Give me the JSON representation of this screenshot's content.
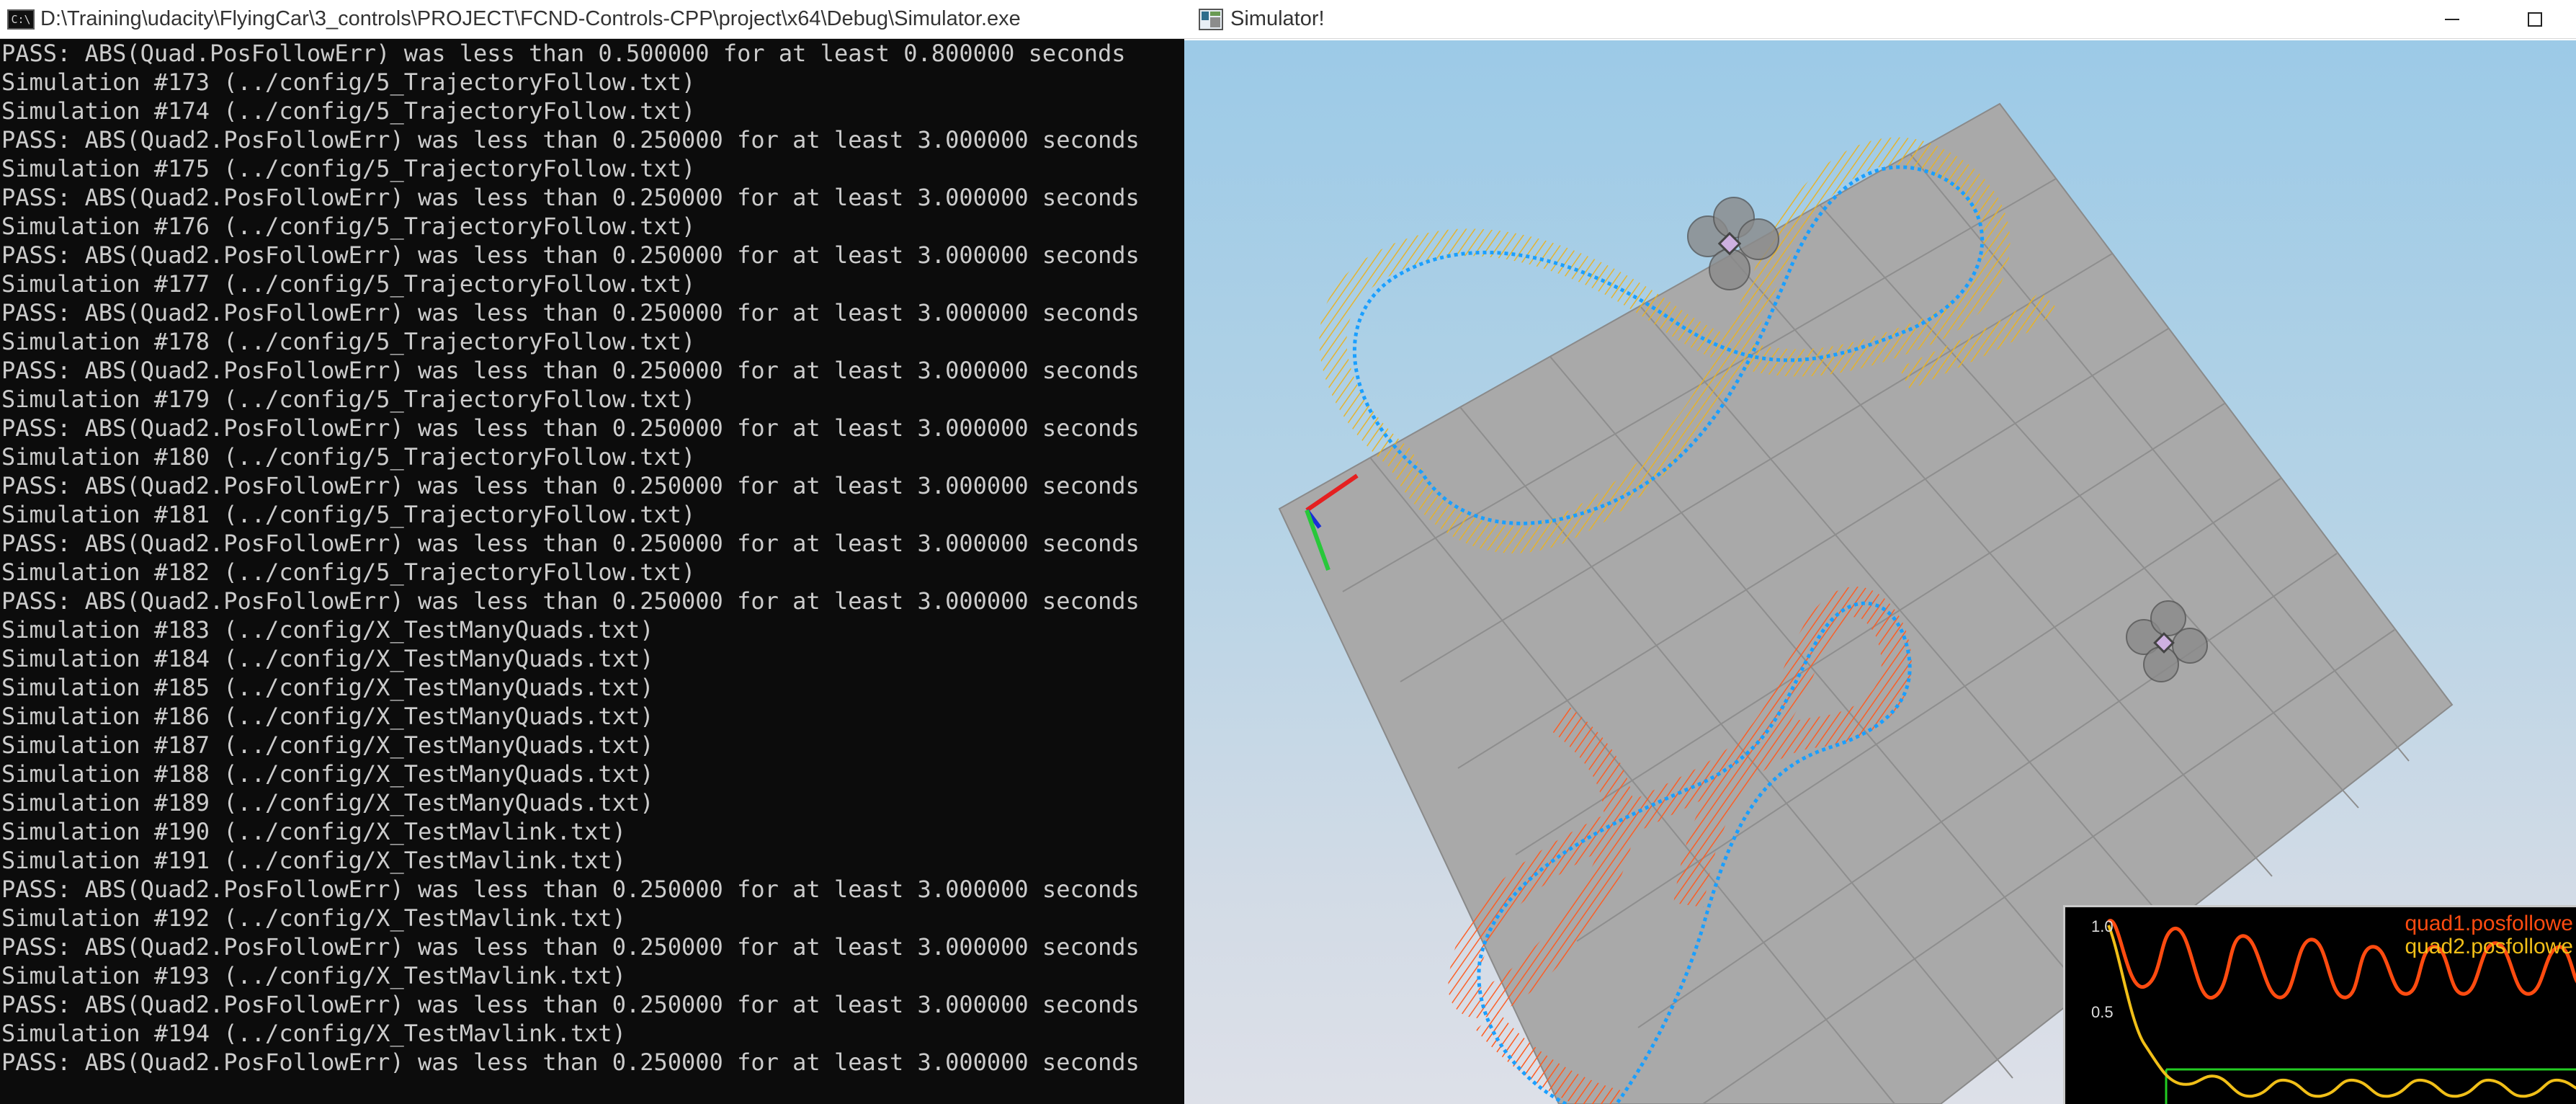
{
  "console": {
    "title": "D:\\Training\\udacity\\FlyingCar\\3_controls\\PROJECT\\FCND-Controls-CPP\\project\\x64\\Debug\\Simulator.exe",
    "icon": "cmd-icon",
    "lines": [
      "PASS: ABS(Quad.PosFollowErr) was less than 0.500000 for at least 0.800000 seconds",
      "Simulation #173 (../config/5_TrajectoryFollow.txt)",
      "Simulation #174 (../config/5_TrajectoryFollow.txt)",
      "PASS: ABS(Quad2.PosFollowErr) was less than 0.250000 for at least 3.000000 seconds",
      "Simulation #175 (../config/5_TrajectoryFollow.txt)",
      "PASS: ABS(Quad2.PosFollowErr) was less than 0.250000 for at least 3.000000 seconds",
      "Simulation #176 (../config/5_TrajectoryFollow.txt)",
      "PASS: ABS(Quad2.PosFollowErr) was less than 0.250000 for at least 3.000000 seconds",
      "Simulation #177 (../config/5_TrajectoryFollow.txt)",
      "PASS: ABS(Quad2.PosFollowErr) was less than 0.250000 for at least 3.000000 seconds",
      "Simulation #178 (../config/5_TrajectoryFollow.txt)",
      "PASS: ABS(Quad2.PosFollowErr) was less than 0.250000 for at least 3.000000 seconds",
      "Simulation #179 (../config/5_TrajectoryFollow.txt)",
      "PASS: ABS(Quad2.PosFollowErr) was less than 0.250000 for at least 3.000000 seconds",
      "Simulation #180 (../config/5_TrajectoryFollow.txt)",
      "PASS: ABS(Quad2.PosFollowErr) was less than 0.250000 for at least 3.000000 seconds",
      "Simulation #181 (../config/5_TrajectoryFollow.txt)",
      "PASS: ABS(Quad2.PosFollowErr) was less than 0.250000 for at least 3.000000 seconds",
      "Simulation #182 (../config/5_TrajectoryFollow.txt)",
      "PASS: ABS(Quad2.PosFollowErr) was less than 0.250000 for at least 3.000000 seconds",
      "Simulation #183 (../config/X_TestManyQuads.txt)",
      "Simulation #184 (../config/X_TestManyQuads.txt)",
      "Simulation #185 (../config/X_TestManyQuads.txt)",
      "Simulation #186 (../config/X_TestManyQuads.txt)",
      "Simulation #187 (../config/X_TestManyQuads.txt)",
      "Simulation #188 (../config/X_TestManyQuads.txt)",
      "Simulation #189 (../config/X_TestManyQuads.txt)",
      "Simulation #190 (../config/X_TestMavlink.txt)",
      "Simulation #191 (../config/X_TestMavlink.txt)",
      "PASS: ABS(Quad2.PosFollowErr) was less than 0.250000 for at least 3.000000 seconds",
      "Simulation #192 (../config/X_TestMavlink.txt)",
      "PASS: ABS(Quad2.PosFollowErr) was less than 0.250000 for at least 3.000000 seconds",
      "Simulation #193 (../config/X_TestMavlink.txt)",
      "PASS: ABS(Quad2.PosFollowErr) was less than 0.250000 for at least 3.000000 seconds",
      "Simulation #194 (../config/X_TestMavlink.txt)",
      "PASS: ABS(Quad2.PosFollowErr) was less than 0.250000 for at least 3.000000 seconds"
    ]
  },
  "simulator": {
    "title": "Simulator!",
    "icon": "app-icon",
    "minimize_icon": "minimize-icon",
    "maximize_icon": "maximize-icon",
    "colors": {
      "quad1_path": "#ff5a1f",
      "quad2_path": "#f2c12e",
      "target_path": "#1a9fff",
      "ground": "#a9a9a9"
    },
    "graph": {
      "legend": [
        "quad1.posfollowe",
        "quad2.posfollowe"
      ],
      "ticks": [
        "1.0",
        "0.5"
      ],
      "colors": {
        "quad1": "#ff4b10",
        "quad2": "#f1bf18",
        "threshold": "#22cc22"
      }
    }
  }
}
